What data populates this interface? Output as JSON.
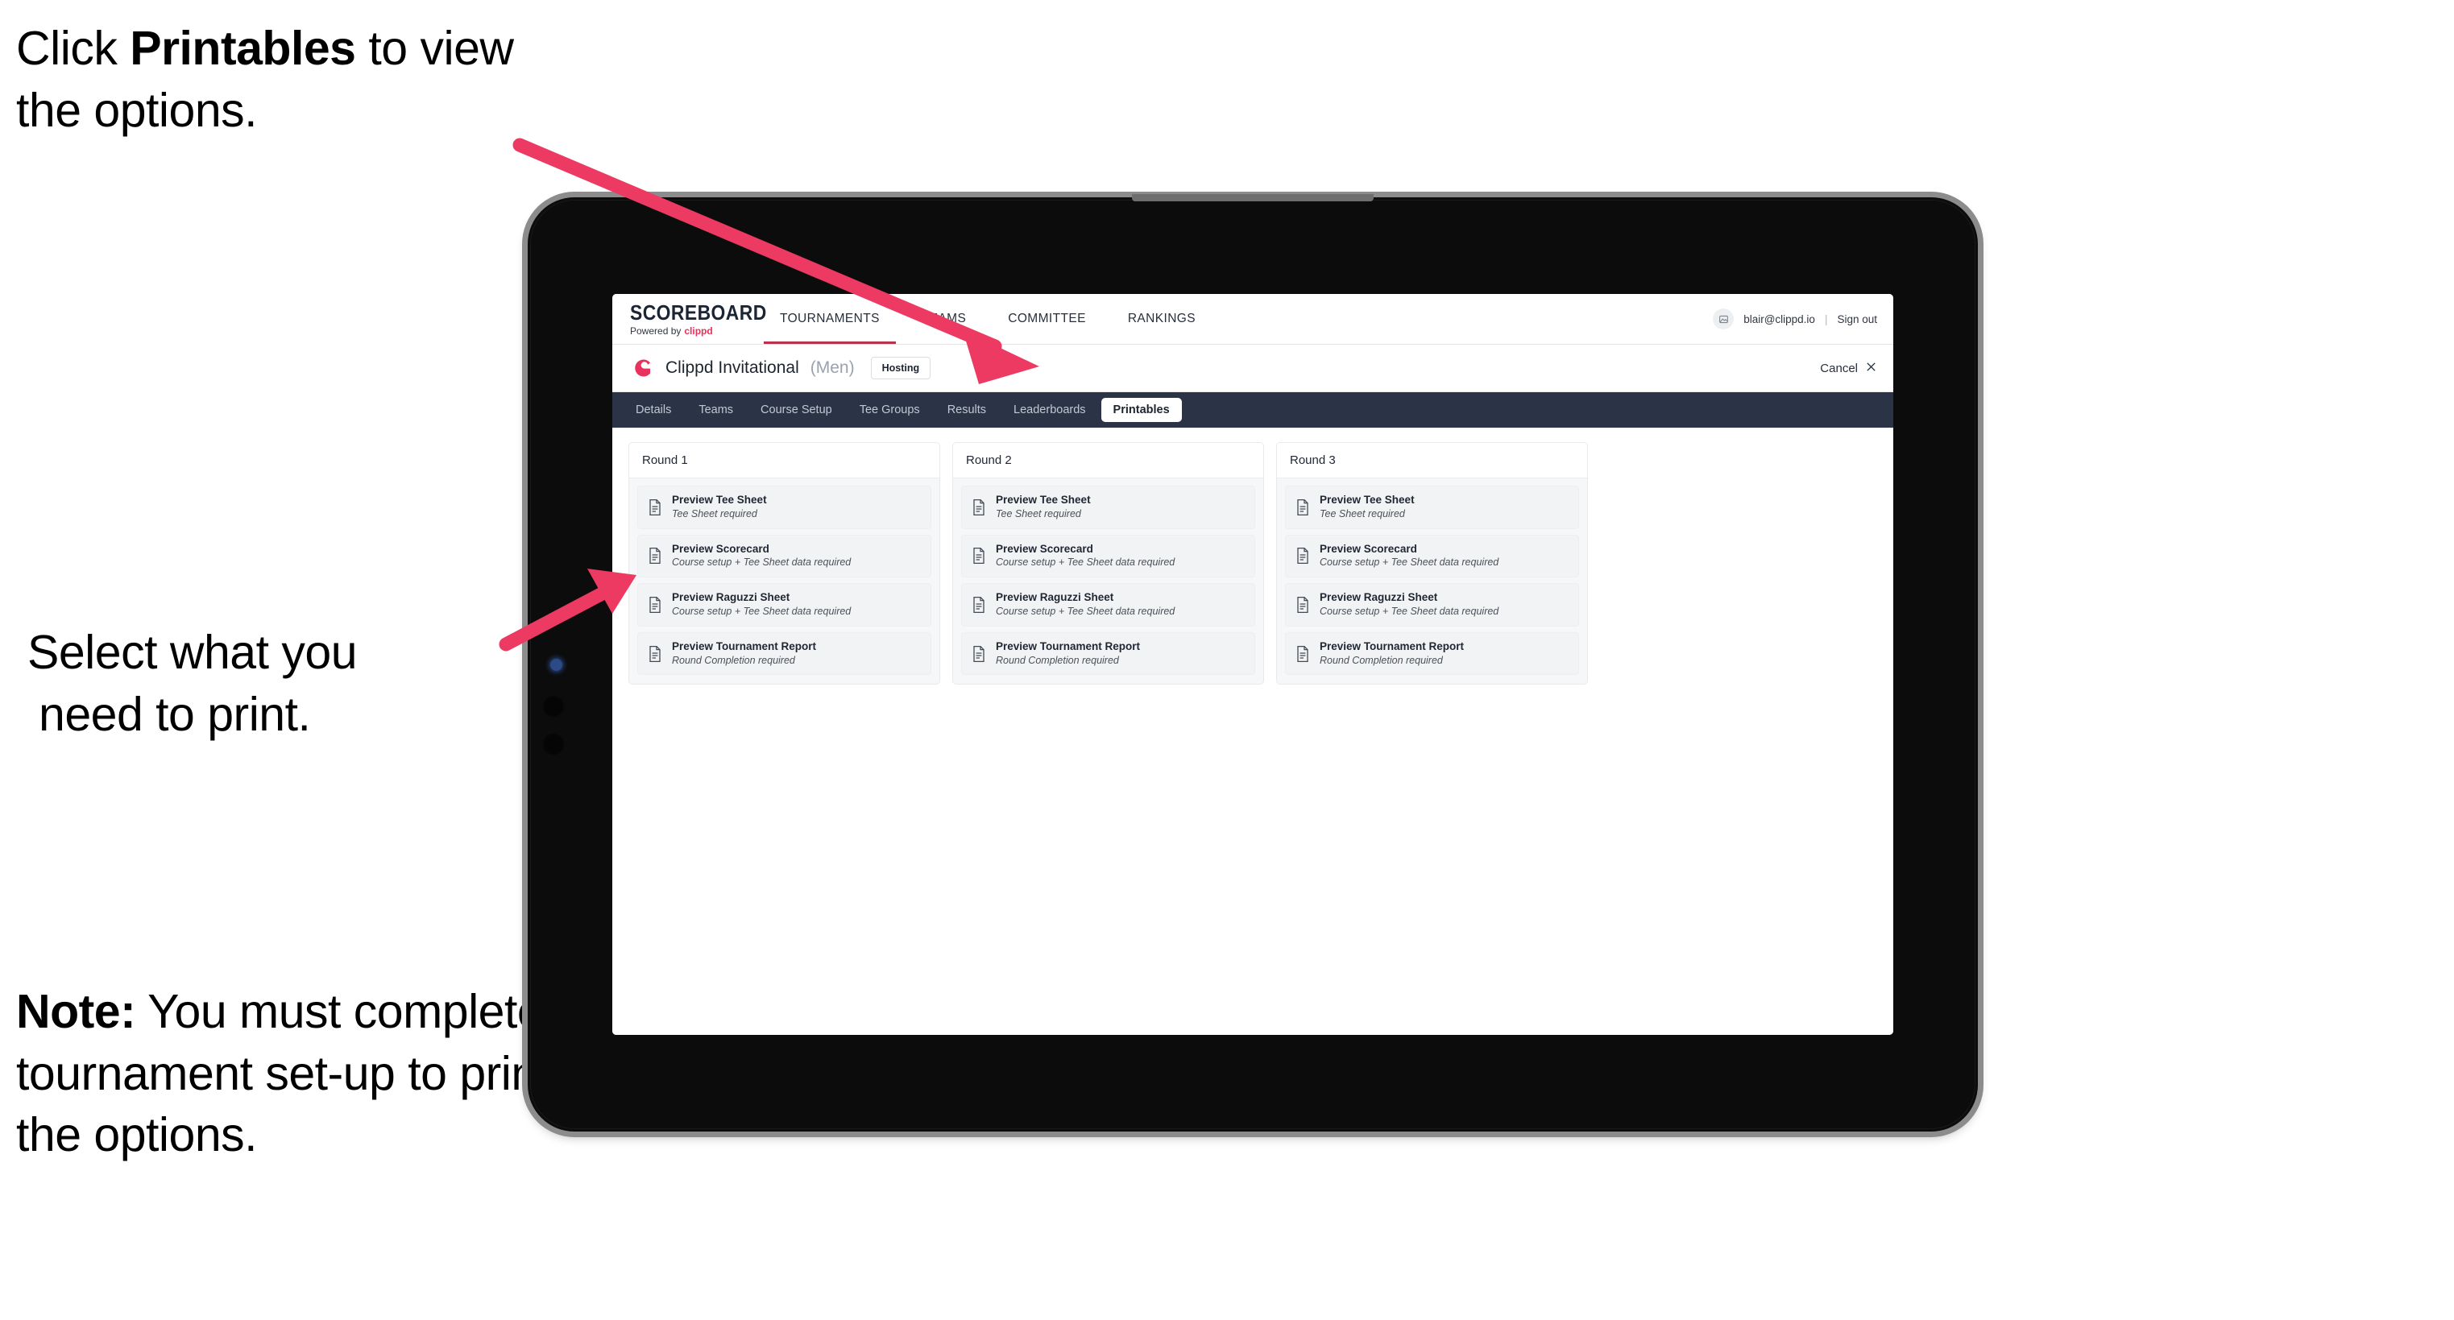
{
  "annotations": {
    "click_printables": "Click Printables to view the options.",
    "click_printables_pre": "Click ",
    "click_printables_bold": "Printables",
    "click_printables_post": " to view the options.",
    "select_line1": "Select what you",
    "select_line2": "need to print.",
    "note_bold": "Note:",
    "note_rest": " You must complete the tournament set-up to print all the options."
  },
  "colors": {
    "accent_pink": "#ec3a63",
    "brand_red": "#e8315c",
    "subnav_dark": "#2a3446",
    "device_bezel": "#0c0c0c",
    "device_edge": "#8c8c8c"
  },
  "app": {
    "brand": {
      "title": "SCOREBOARD",
      "powered_by": "Powered by",
      "powered_brand": "clippd"
    },
    "main_nav": [
      {
        "label": "TOURNAMENTS",
        "active": true
      },
      {
        "label": "TEAMS",
        "active": false
      },
      {
        "label": "COMMITTEE",
        "active": false
      },
      {
        "label": "RANKINGS",
        "active": false
      }
    ],
    "account": {
      "avatar_icon": "user-avatar-icon",
      "email": "blair@clippd.io",
      "separator": "|",
      "sign_out": "Sign out"
    },
    "tournament": {
      "logo_icon": "clippd-c-logo-icon",
      "name": "Clippd Invitational",
      "gender": "(Men)",
      "status_badge": "Hosting",
      "cancel_label": "Cancel",
      "cancel_icon": "close-x-icon"
    },
    "sub_nav": [
      {
        "label": "Details",
        "active": false
      },
      {
        "label": "Teams",
        "active": false
      },
      {
        "label": "Course Setup",
        "active": false
      },
      {
        "label": "Tee Groups",
        "active": false
      },
      {
        "label": "Results",
        "active": false
      },
      {
        "label": "Leaderboards",
        "active": false
      },
      {
        "label": "Printables",
        "active": true
      }
    ],
    "rounds": [
      {
        "title": "Round 1",
        "items": [
          {
            "icon": "document-icon",
            "title": "Preview Tee Sheet",
            "subtitle": "Tee Sheet required"
          },
          {
            "icon": "document-icon",
            "title": "Preview Scorecard",
            "subtitle": "Course setup + Tee Sheet data required"
          },
          {
            "icon": "document-icon",
            "title": "Preview Raguzzi Sheet",
            "subtitle": "Course setup + Tee Sheet data required"
          },
          {
            "icon": "document-icon",
            "title": "Preview Tournament Report",
            "subtitle": "Round Completion required"
          }
        ]
      },
      {
        "title": "Round 2",
        "items": [
          {
            "icon": "document-icon",
            "title": "Preview Tee Sheet",
            "subtitle": "Tee Sheet required"
          },
          {
            "icon": "document-icon",
            "title": "Preview Scorecard",
            "subtitle": "Course setup + Tee Sheet data required"
          },
          {
            "icon": "document-icon",
            "title": "Preview Raguzzi Sheet",
            "subtitle": "Course setup + Tee Sheet data required"
          },
          {
            "icon": "document-icon",
            "title": "Preview Tournament Report",
            "subtitle": "Round Completion required"
          }
        ]
      },
      {
        "title": "Round 3",
        "items": [
          {
            "icon": "document-icon",
            "title": "Preview Tee Sheet",
            "subtitle": "Tee Sheet required"
          },
          {
            "icon": "document-icon",
            "title": "Preview Scorecard",
            "subtitle": "Course setup + Tee Sheet data required"
          },
          {
            "icon": "document-icon",
            "title": "Preview Raguzzi Sheet",
            "subtitle": "Course setup + Tee Sheet data required"
          },
          {
            "icon": "document-icon",
            "title": "Preview Tournament Report",
            "subtitle": "Round Completion required"
          }
        ]
      }
    ]
  }
}
